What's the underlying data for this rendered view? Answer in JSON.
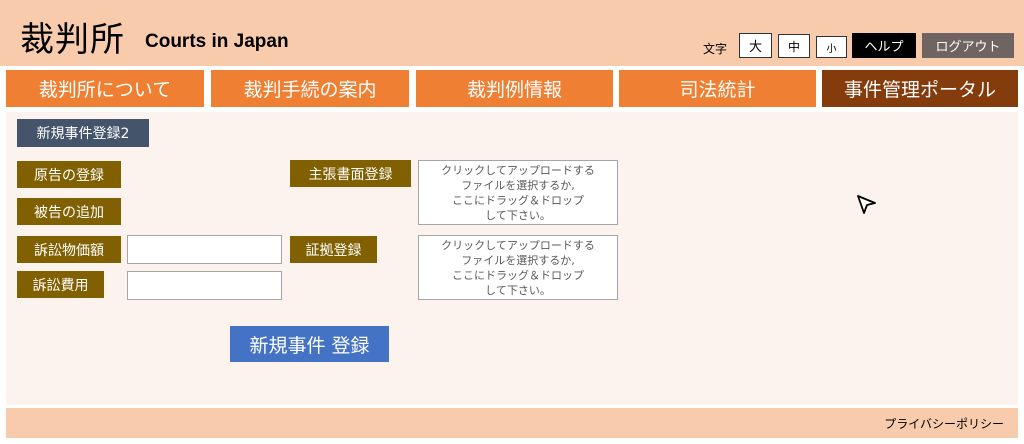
{
  "header": {
    "logo_jp": "裁判所",
    "logo_en": "Courts in Japan",
    "font_size_label": "文字",
    "font_large": "大",
    "font_medium": "中",
    "font_small": "小",
    "help": "ヘルプ",
    "logout": "ログアウト"
  },
  "nav": {
    "items": [
      {
        "label": "裁判所について"
      },
      {
        "label": "裁判手続の案内"
      },
      {
        "label": "裁判例情報"
      },
      {
        "label": "司法統計"
      },
      {
        "label": "事件管理ポータル"
      }
    ],
    "active_index": 4
  },
  "form": {
    "title": "新規事件登録2",
    "plaintiff_label": "原告の登録",
    "defendant_label": "被告の追加",
    "claim_value_label": "訴訟物価額",
    "claim_value": "",
    "court_cost_label": "訴訟費用",
    "court_cost": "",
    "brief_label": "主張書面登録",
    "evidence_label": "証拠登録",
    "dropzone_lines": [
      "クリックしてアップロードする",
      "ファイルを選択するか,",
      "ここにドラッグ＆ドロップ",
      "して下さい。"
    ],
    "submit": "新規事件 登録"
  },
  "footer": {
    "privacy": "プライバシーポリシー"
  },
  "colors": {
    "header_bg": "#f8cbad",
    "nav_bg": "#ee7f33",
    "nav_active_bg": "#843c0c",
    "label_bg": "#806000",
    "panel_header_bg": "#44546a",
    "submit_bg": "#4472c4",
    "main_bg": "#fdf3ee"
  }
}
